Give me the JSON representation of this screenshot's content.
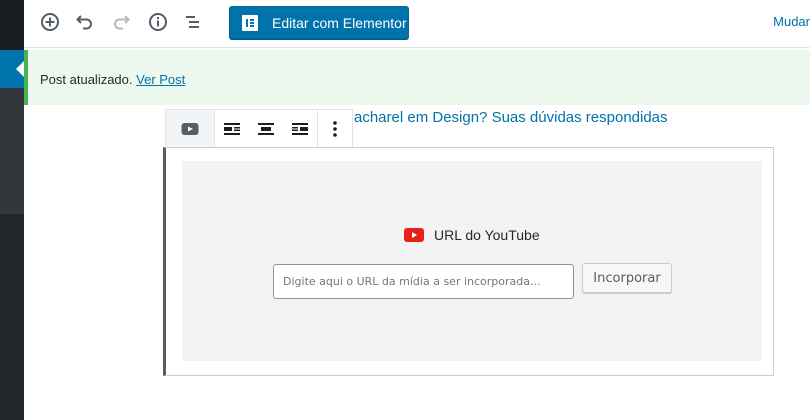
{
  "toolbar": {
    "elementor_label": "Editar com Elementor",
    "mudar_label": "Mudar"
  },
  "icons": {
    "add": "plus-circle-icon",
    "undo": "undo-icon",
    "redo": "redo-icon",
    "info": "info-icon",
    "outline": "list-outline-icon",
    "elementor": "elementor-icon",
    "youtube": "youtube-icon",
    "align_left": "align-left-icon",
    "align_center": "align-center-icon",
    "align_right": "align-right-icon",
    "more": "more-vertical-icon"
  },
  "notice": {
    "text": "Post atualizado.",
    "link": "Ver Post"
  },
  "post": {
    "title_fragment": "acharel em Design? Suas dúvidas respondidas"
  },
  "embed": {
    "label": "URL do YouTube",
    "input_placeholder": "Digite aqui o URL da mídia a ser incorporada...",
    "input_value": "",
    "button_label": "Incorporar"
  },
  "colors": {
    "accent": "#0073aa",
    "notice_border": "#46b450",
    "notice_bg": "#ecf7ed",
    "youtube_red": "#e62117",
    "admin_dark": "#23282d"
  }
}
